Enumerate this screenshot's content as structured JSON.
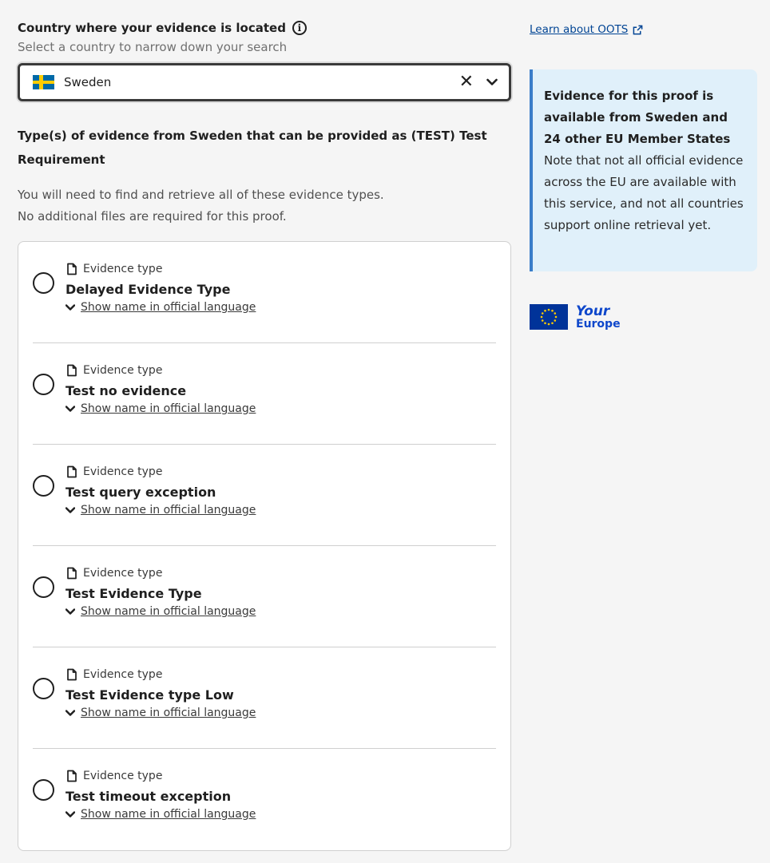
{
  "country": {
    "label": "Country where your evidence is located",
    "hint": "Select a country to narrow down your search",
    "selected": "Sweden",
    "icons": {
      "info": "info-icon",
      "flag": "sweden-flag-icon",
      "clear": "close-icon",
      "dropdown": "chevron-down-icon"
    }
  },
  "section": {
    "title": "Type(s) of evidence from Sweden that can be provided as (TEST) Test Requirement",
    "desc_line1": "You will need to find and retrieve all of these evidence types.",
    "desc_line2": "No additional files are required for this proof."
  },
  "evidence_items": [
    {
      "type_label": "Evidence type",
      "name": "Delayed Evidence Type",
      "toggle": "Show name in official language"
    },
    {
      "type_label": "Evidence type",
      "name": "Test no evidence",
      "toggle": "Show name in official language"
    },
    {
      "type_label": "Evidence type",
      "name": "Test query exception",
      "toggle": "Show name in official language"
    },
    {
      "type_label": "Evidence type",
      "name": "Test Evidence Type",
      "toggle": "Show name in official language"
    },
    {
      "type_label": "Evidence type",
      "name": "Test Evidence type Low",
      "toggle": "Show name in official language"
    },
    {
      "type_label": "Evidence type",
      "name": "Test timeout exception",
      "toggle": "Show name in official language"
    }
  ],
  "sidebar": {
    "learn_link": "Learn about OOTS",
    "info_bold": "Evidence for this proof is available from Sweden and 24 other EU Member States",
    "info_text": "Note that not all official evidence across the EU are available with this service, and not all countries support online retrieval yet.",
    "logo_your": "Your",
    "logo_europe": "Europe"
  },
  "colors": {
    "accent": "#3a7dc9",
    "link": "#004494",
    "info_bg": "#e0f0fa",
    "page_bg": "#f5f5f5"
  }
}
